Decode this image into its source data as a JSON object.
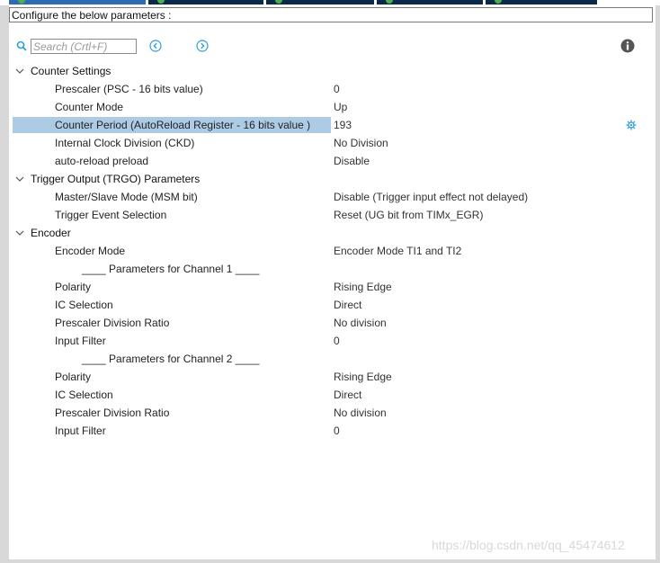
{
  "header": {
    "configure_text": "Configure the below parameters :"
  },
  "search": {
    "placeholder": "Search (Crtl+F)"
  },
  "icons": {
    "search": "search-icon",
    "prev": "chevron-left-circle-icon",
    "next": "chevron-right-circle-icon",
    "info": "info-icon",
    "gear": "gear-icon",
    "collapse": "chevron-down-icon"
  },
  "colors": {
    "accent": "#2f9fd8",
    "selection": "#aecbe6",
    "tab_dark": "#0b2a4a",
    "tab_active": "#2f6bb5",
    "tab_dot": "#4caf50"
  },
  "groups": {
    "counter": {
      "label": "Counter Settings",
      "params": [
        {
          "label": "Prescaler (PSC - 16 bits value)",
          "value": "0"
        },
        {
          "label": "Counter Mode",
          "value": "Up"
        },
        {
          "label": "Counter Period (AutoReload Register - 16 bits value )",
          "value": "193"
        },
        {
          "label": "Internal Clock Division (CKD)",
          "value": "No Division"
        },
        {
          "label": "auto-reload preload",
          "value": "Disable"
        }
      ]
    },
    "trigger": {
      "label": "Trigger Output (TRGO) Parameters",
      "params": [
        {
          "label": "Master/Slave Mode (MSM bit)",
          "value": "Disable (Trigger input effect not delayed)"
        },
        {
          "label": "Trigger Event Selection",
          "value": "Reset (UG bit from TIMx_EGR)"
        }
      ]
    },
    "encoder": {
      "label": "Encoder",
      "mode": {
        "label": "Encoder Mode",
        "value": "Encoder Mode TI1 and TI2"
      },
      "ch1_header": "____ Parameters for Channel 1 ____",
      "ch1": [
        {
          "label": "Polarity",
          "value": "Rising Edge"
        },
        {
          "label": "IC Selection",
          "value": "Direct"
        },
        {
          "label": "Prescaler Division Ratio",
          "value": "No division"
        },
        {
          "label": "Input Filter",
          "value": "0"
        }
      ],
      "ch2_header": "____ Parameters for Channel 2 ____",
      "ch2": [
        {
          "label": "Polarity",
          "value": "Rising Edge"
        },
        {
          "label": "IC Selection",
          "value": "Direct"
        },
        {
          "label": "Prescaler Division Ratio",
          "value": "No division"
        },
        {
          "label": "Input Filter",
          "value": "0"
        }
      ]
    }
  },
  "watermark": "https://blog.csdn.net/qq_45474612"
}
